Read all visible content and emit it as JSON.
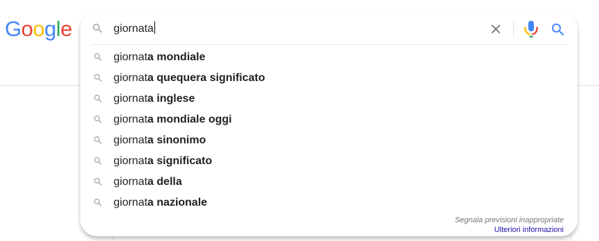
{
  "logo": {
    "letters": [
      {
        "char": "G",
        "color": "#4285F4"
      },
      {
        "char": "o",
        "color": "#EA4335"
      },
      {
        "char": "o",
        "color": "#FBBC05"
      },
      {
        "char": "g",
        "color": "#4285F4"
      },
      {
        "char": "l",
        "color": "#34A853"
      },
      {
        "char": "e",
        "color": "#EA4335"
      }
    ]
  },
  "search": {
    "query": "giornata",
    "icons": {
      "leading": "search-icon",
      "clear": "close-icon",
      "voice": "microphone-icon",
      "submit": "search-icon"
    }
  },
  "suggestions": [
    {
      "prefix": "giornat",
      "completion": "a mondiale"
    },
    {
      "prefix": "giornat",
      "completion": "a quequera significato"
    },
    {
      "prefix": "giornat",
      "completion": "a inglese"
    },
    {
      "prefix": "giornat",
      "completion": "a mondiale oggi"
    },
    {
      "prefix": "giornat",
      "completion": "a sinonimo"
    },
    {
      "prefix": "giornat",
      "completion": "a significato"
    },
    {
      "prefix": "giornat",
      "completion": "a della"
    },
    {
      "prefix": "giornat",
      "completion": "a nazionale"
    }
  ],
  "footer": {
    "report": "Segnala previsioni inappropriate",
    "more": "Ulteriori informazioni"
  },
  "colors": {
    "text": "#202124",
    "muted_icon": "#9aa0a6",
    "link": "#1a0dab",
    "accent_blue": "#4285F4"
  }
}
